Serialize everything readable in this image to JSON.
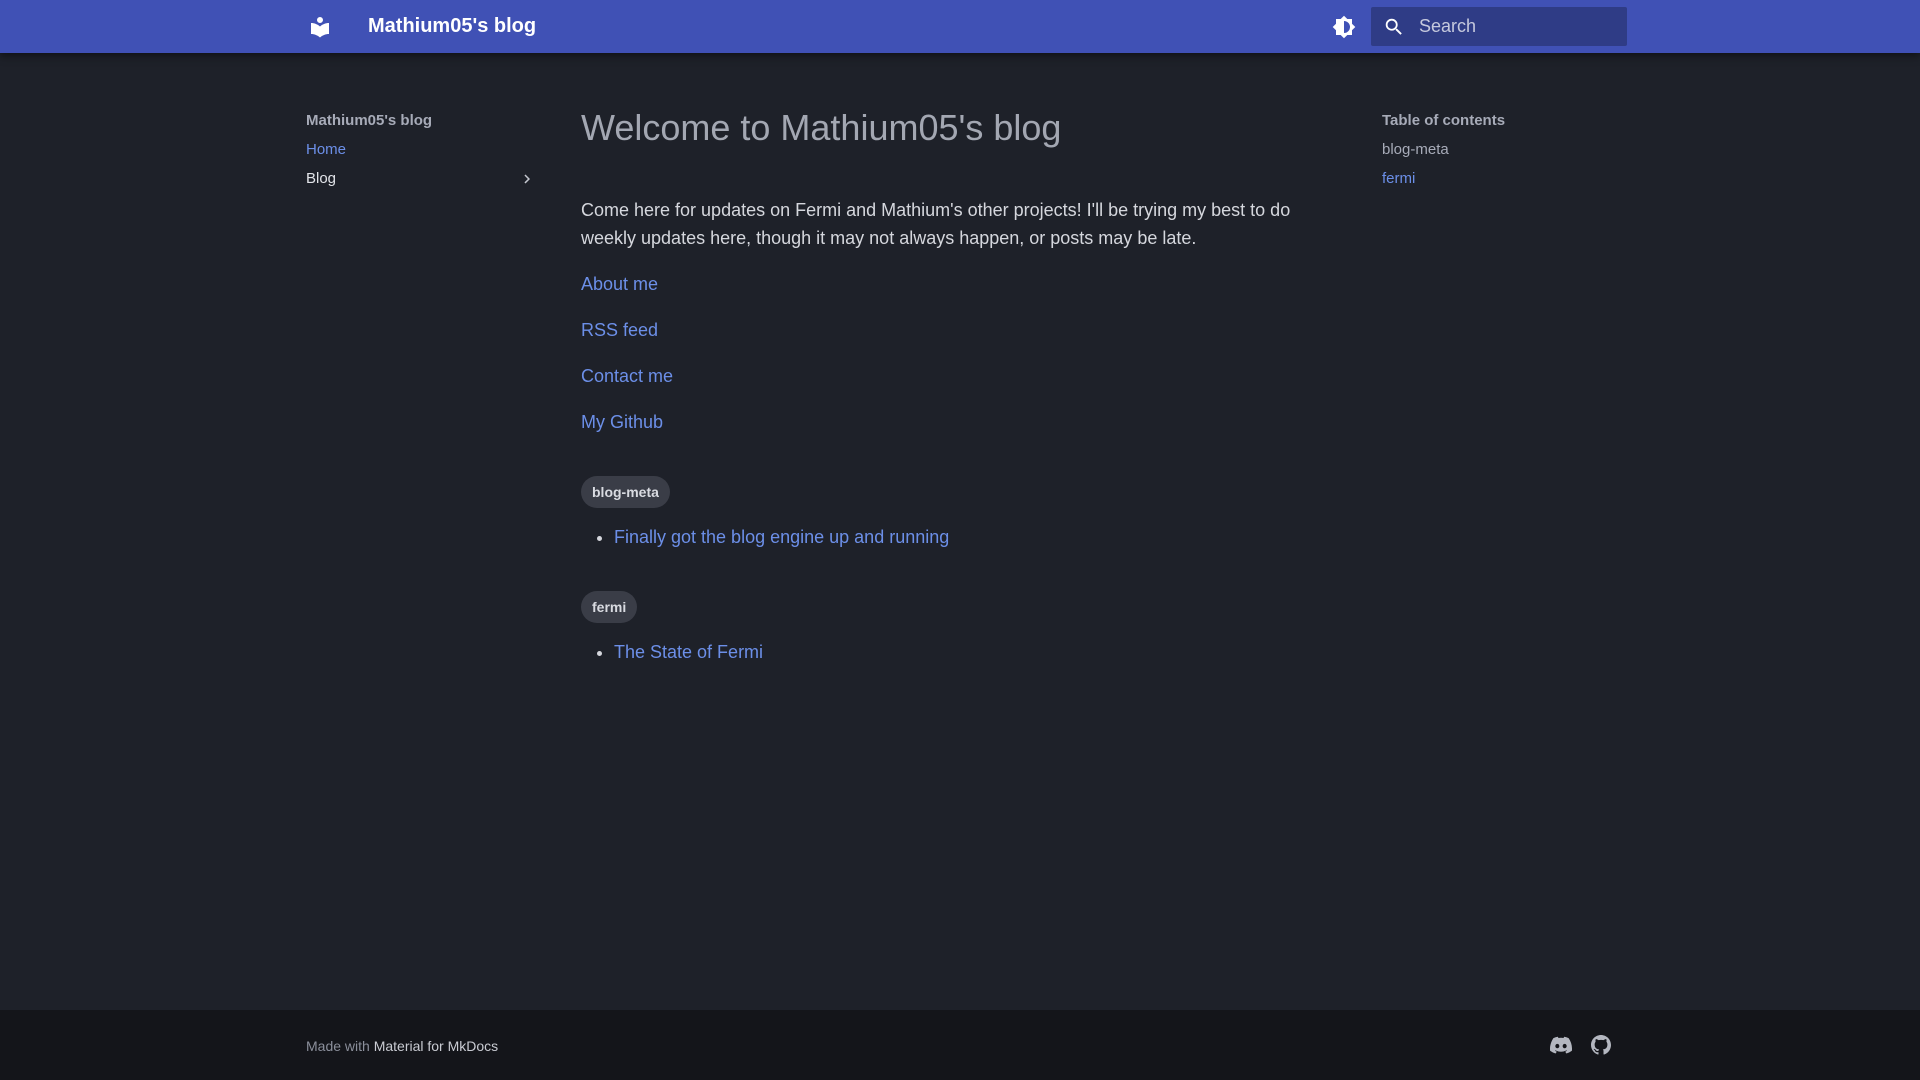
{
  "header": {
    "site_title": "Mathium05's blog",
    "logo_icon": "book-open-icon",
    "theme_toggle_icon": "brightness-icon",
    "search": {
      "placeholder": "Search",
      "value": "",
      "icon": "search-icon"
    }
  },
  "nav": {
    "title": "Mathium05's blog",
    "items": [
      {
        "label": "Home",
        "active": true
      },
      {
        "label": "Blog",
        "active": false,
        "icon": "chevron-right-icon"
      }
    ]
  },
  "main": {
    "title": "Welcome to Mathium05's blog",
    "intro": "Come here for updates on Fermi and Mathium's other projects! I'll be trying my best to do weekly updates here, though it may not always happen, or posts may be late.",
    "links": [
      {
        "label": "About me"
      },
      {
        "label": "RSS feed"
      },
      {
        "label": "Contact me"
      },
      {
        "label": "My Github"
      }
    ],
    "tags": [
      {
        "name": "blog-meta",
        "posts": [
          {
            "title": "Finally got the blog engine up and running"
          }
        ]
      },
      {
        "name": "fermi",
        "posts": [
          {
            "title": "The State of Fermi"
          }
        ]
      }
    ]
  },
  "toc": {
    "title": "Table of contents",
    "items": [
      {
        "label": "blog-meta",
        "active": false
      },
      {
        "label": "fermi",
        "active": true
      }
    ]
  },
  "footer": {
    "made_with_prefix": "Made with",
    "made_with_link": "Material for MkDocs",
    "social": [
      {
        "icon": "discord-icon"
      },
      {
        "icon": "github-icon"
      }
    ]
  },
  "colors": {
    "header_bg": "#4051b5",
    "page_bg": "#1e2129",
    "footer_bg": "#14151a",
    "link": "#6c8fe8"
  }
}
